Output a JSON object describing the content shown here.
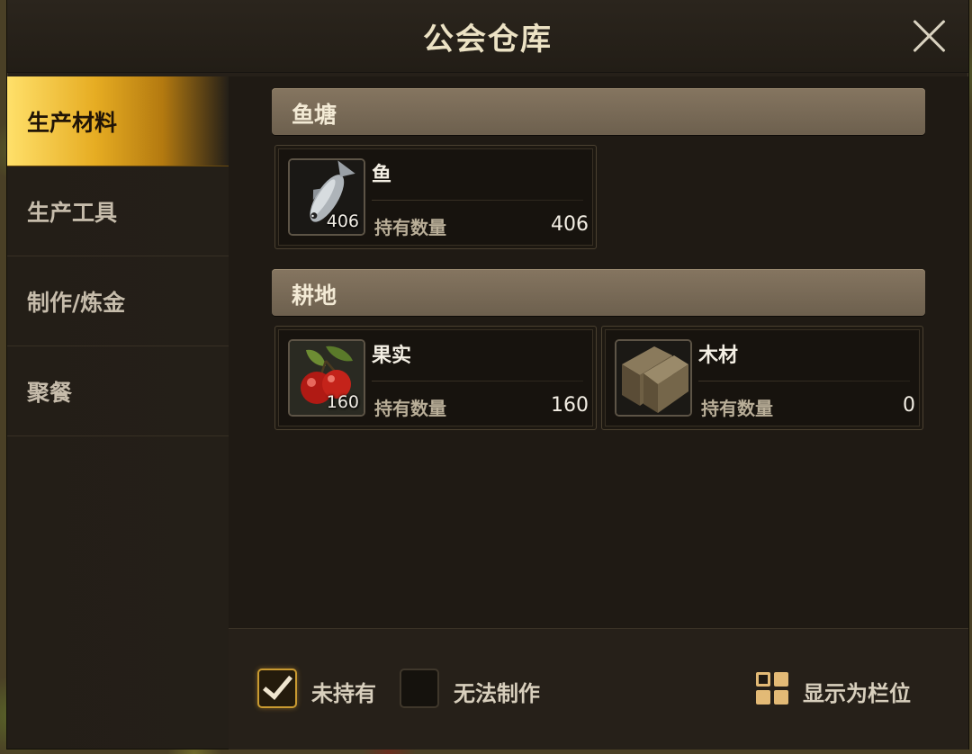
{
  "window": {
    "title": "公会仓库"
  },
  "sidebar": {
    "items": [
      {
        "label": "生产材料",
        "active": true
      },
      {
        "label": "生产工具",
        "active": false
      },
      {
        "label": "制作/炼金",
        "active": false
      },
      {
        "label": "聚餐",
        "active": false
      }
    ]
  },
  "sections": [
    {
      "title": "鱼塘",
      "items": [
        {
          "name": "鱼",
          "icon": "fish-icon",
          "icon_count": "406",
          "own_label": "持有数量",
          "own_value": "406"
        }
      ]
    },
    {
      "title": "耕地",
      "items": [
        {
          "name": "果实",
          "icon": "berries-icon",
          "icon_count": "160",
          "own_label": "持有数量",
          "own_value": "160"
        },
        {
          "name": "木材",
          "icon": "wood-icon",
          "icon_count": "",
          "own_label": "持有数量",
          "own_value": "0"
        }
      ]
    }
  ],
  "filters": {
    "not_owned": {
      "label": "未持有",
      "checked": true
    },
    "cannot_craft": {
      "label": "无法制作",
      "checked": false
    }
  },
  "view_toggle": {
    "label": "显示为栏位",
    "icon": "grid-view-icon"
  },
  "colors": {
    "accent_gold": "#e6ac22",
    "section_header": "#7a6b56",
    "panel_bg": "#262019"
  }
}
